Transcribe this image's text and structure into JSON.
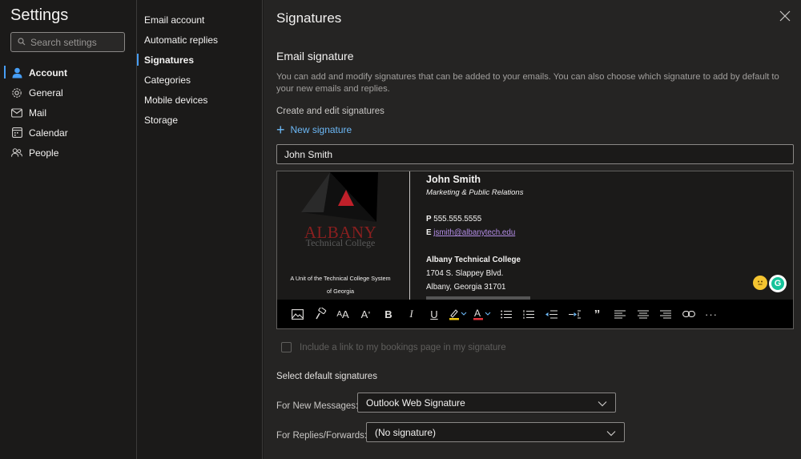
{
  "nav": {
    "title": "Settings",
    "search_placeholder": "Search settings",
    "items": [
      {
        "label": "Account",
        "icon": "person-icon",
        "active": true
      },
      {
        "label": "General",
        "icon": "gear-icon",
        "active": false
      },
      {
        "label": "Mail",
        "icon": "mail-icon",
        "active": false
      },
      {
        "label": "Calendar",
        "icon": "calendar-icon",
        "active": false
      },
      {
        "label": "People",
        "icon": "people-icon",
        "active": false
      }
    ]
  },
  "subnav": {
    "items": [
      {
        "label": "Email account",
        "active": false
      },
      {
        "label": "Automatic replies",
        "active": false
      },
      {
        "label": "Signatures",
        "active": true
      },
      {
        "label": "Categories",
        "active": false
      },
      {
        "label": "Mobile devices",
        "active": false
      },
      {
        "label": "Storage",
        "active": false
      }
    ]
  },
  "panel": {
    "title": "Signatures",
    "section_title": "Email signature",
    "description": "You can add and modify signatures that can be added to your emails. You can also choose which signature to add by default to your new emails and replies.",
    "create_label": "Create and edit signatures",
    "new_signature_label": "New signature",
    "signature_name": "John Smith",
    "signature": {
      "logo_line1": "ALBANY",
      "logo_line2": "Technical College",
      "unit_line1": "A Unit of the Technical College System",
      "unit_line2": "of Georgia",
      "name": "John Smith",
      "role": "Marketing & Public Relations",
      "phone_prefix": "P",
      "phone": "555.555.5555",
      "email_prefix": "E",
      "email": "jsmith@albanytech.edu",
      "company": "Albany Technical College",
      "address1": "1704 S. Slappey Blvd.",
      "address2": "Albany, Georgia 31701"
    },
    "bookings_label": "Include a link to my bookings page in my signature",
    "default_title": "Select default signatures",
    "new_messages_label": "For New Messages:",
    "new_messages_value": "Outlook Web Signature",
    "replies_label": "For Replies/Forwards:",
    "replies_value": "(No signature)"
  },
  "colors": {
    "accent": "#479ef5",
    "link": "#6cb8f6",
    "logo_red": "#8a1f1f",
    "highlight_yellow": "#f2c811",
    "font_red": "#e3343b"
  }
}
